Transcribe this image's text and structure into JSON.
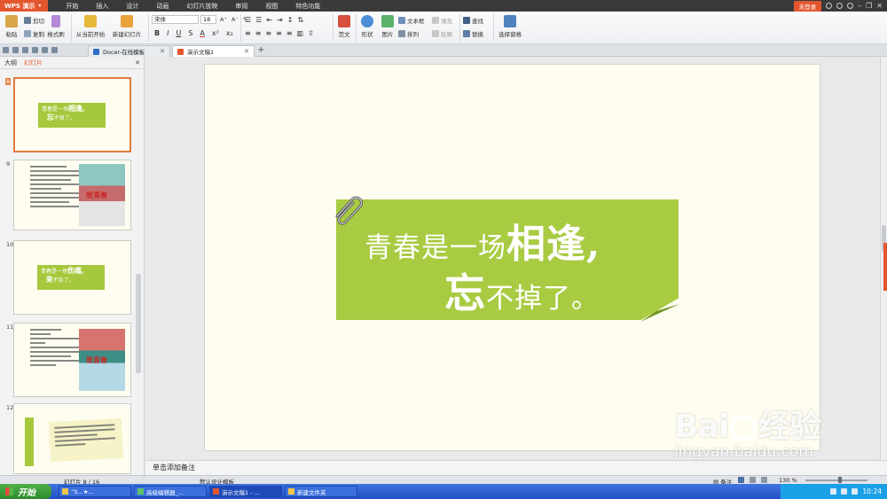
{
  "app": {
    "name": "WPS 演示",
    "menu": [
      "开始",
      "插入",
      "设计",
      "动画",
      "幻灯片放映",
      "审阅",
      "视图",
      "特色功能"
    ],
    "login": "未登录"
  },
  "ribbon": {
    "paste": "粘贴",
    "cut": "剪切",
    "copy": "复制",
    "format_painter": "格式刷",
    "from_current": "从当前开始",
    "new_slide": "新建幻灯片",
    "font_name": "宋体",
    "font_size": "18",
    "template": "范文",
    "shape": "形状",
    "picture": "图片",
    "textbox": "文本框",
    "fill": "填充",
    "arrange": "排列",
    "outline": "轮廓",
    "find": "查找",
    "replace": "替换",
    "select_pane": "选择窗格"
  },
  "tabs": [
    {
      "label": "Docer-在线模板"
    },
    {
      "label": "演示文稿1"
    }
  ],
  "left_panel": {
    "tab_outline": "大纲",
    "tab_slides": "幻灯片",
    "slide_numbers": [
      "8",
      "9",
      "10",
      "11",
      "12"
    ],
    "thumb8": {
      "line1": "青春是一场",
      "big1": "相逢,",
      "big2": "忘",
      "line2": "不掉了。"
    },
    "thumb10": {
      "line1": "青春是一场",
      "big1": "伤痛,",
      "big2": "来",
      "line2": "不及了。"
    },
    "thumb_photo_label": "致青春"
  },
  "slide": {
    "line1_prefix": "青春是一场",
    "line1_big": "相逢,",
    "line2_big": "忘",
    "line2_suffix": "不掉了。"
  },
  "notes_placeholder": "单击添加备注",
  "status": {
    "slide_counter": "幻灯片 8 / 16",
    "theme": "默认设计模板",
    "notes_btn": "备注",
    "zoom": "130 %"
  },
  "taskbar": {
    "start": "开始",
    "tasks": [
      "“S...★...",
      "高级编辑器_...",
      "演示文稿1 - ...",
      "新建文件夹"
    ],
    "clock": "10:24"
  },
  "watermark": {
    "main_a": "Bai",
    "main_b": "经验",
    "url": "jingyan.baidu.com"
  },
  "colors": {
    "accent": "#e4572e",
    "sticky": "#a8cb42",
    "slide_bg": "#fffdf0"
  }
}
